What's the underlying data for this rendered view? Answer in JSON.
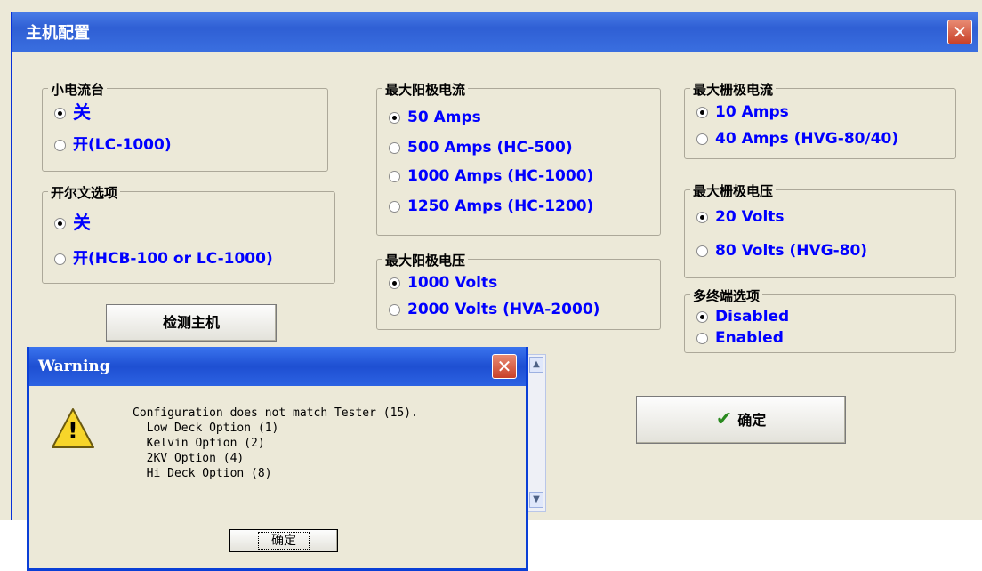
{
  "main": {
    "title": "主机配置",
    "close_glyph": "✕"
  },
  "groups": {
    "low_current": {
      "title": "小电流台",
      "options": [
        {
          "label": "关",
          "selected": true
        },
        {
          "label": "开(LC-1000)",
          "selected": false
        }
      ]
    },
    "kelvin": {
      "title": "开尔文选项",
      "options": [
        {
          "label": "关",
          "selected": true
        },
        {
          "label": "开(HCB-100 or LC-1000)",
          "selected": false
        }
      ]
    },
    "max_anode_current": {
      "title": "最大阳极电流",
      "options": [
        {
          "label": "50 Amps",
          "selected": true
        },
        {
          "label": "500 Amps   (HC-500)",
          "selected": false
        },
        {
          "label": "1000 Amps (HC-1000)",
          "selected": false
        },
        {
          "label": "1250 Amps (HC-1200)",
          "selected": false
        }
      ]
    },
    "max_anode_voltage": {
      "title": "最大阳极电压",
      "options": [
        {
          "label": "1000 Volts",
          "selected": true
        },
        {
          "label": "2000 Volts (HVA-2000)",
          "selected": false
        }
      ]
    },
    "max_gate_current": {
      "title": "最大栅极电流",
      "options": [
        {
          "label": "10 Amps",
          "selected": true
        },
        {
          "label": "40 Amps (HVG-80/40)",
          "selected": false
        }
      ]
    },
    "max_gate_voltage": {
      "title": "最大栅极电压",
      "options": [
        {
          "label": "20 Volts",
          "selected": true
        },
        {
          "label": "80 Volts (HVG-80)",
          "selected": false
        }
      ]
    },
    "multi_terminal": {
      "title": "多终端选项",
      "options": [
        {
          "label": "Disabled",
          "selected": true
        },
        {
          "label": "Enabled",
          "selected": false
        }
      ]
    }
  },
  "buttons": {
    "detect_host": "检测主机",
    "ok": "确定",
    "ok_icon": "✔"
  },
  "warning": {
    "title": "Warning",
    "close_glyph": "✕",
    "icon": "warning-icon",
    "icon_glyph": "!",
    "message": "Configuration does not match Tester (15).\n  Low Deck Option (1)\n  Kelvin Option (2)\n  2KV Option (4)\n  Hi Deck Option (8)",
    "ok_label": "确定"
  },
  "colors": {
    "titlebar": "#2f5fd4",
    "option_text": "#0000ff",
    "window_bg": "#ece9d8",
    "warning_icon": "#f7d52a"
  }
}
